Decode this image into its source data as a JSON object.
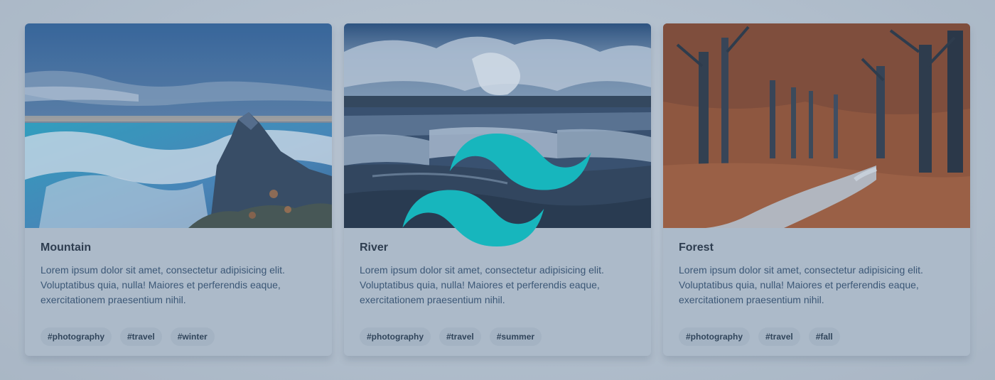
{
  "cards": [
    {
      "title": "Mountain",
      "description": "Lorem ipsum dolor sit amet, consectetur adipisicing elit. Voluptatibus quia, nulla! Maiores et perferendis eaque, exercitationem praesentium nihil.",
      "tags": [
        "#photography",
        "#travel",
        "#winter"
      ],
      "image": "mountain-clouds-photo"
    },
    {
      "title": "River",
      "description": "Lorem ipsum dolor sit amet, consectetur adipisicing elit. Voluptatibus quia, nulla! Maiores et perferendis eaque, exercitationem praesentium nihil.",
      "tags": [
        "#photography",
        "#travel",
        "#summer"
      ],
      "image": "river-waterfall-photo"
    },
    {
      "title": "Forest",
      "description": "Lorem ipsum dolor sit amet, consectetur adipisicing elit. Voluptatibus quia, nulla! Maiores et perferendis eaque, exercitationem praesentium nihil.",
      "tags": [
        "#photography",
        "#travel",
        "#fall"
      ],
      "image": "autumn-forest-path-photo"
    }
  ],
  "logo": {
    "icon": "tailwind-logo-icon",
    "color": "#17b6bd"
  },
  "colors": {
    "background": "#c2cdd8",
    "card": "#bcc8d4",
    "title": "#2f3d4d",
    "text": "#3e5a78",
    "tag_bg": "#b3c0cd"
  }
}
